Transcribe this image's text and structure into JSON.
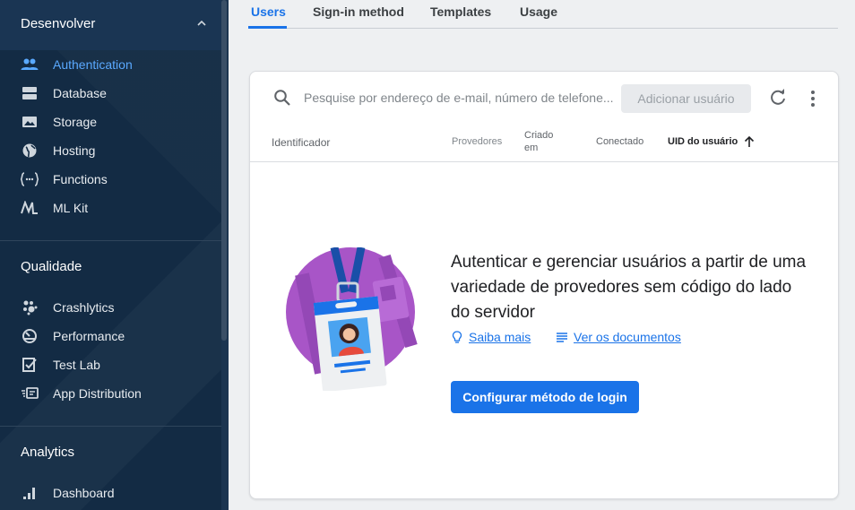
{
  "sidebar": {
    "sections": [
      {
        "title": "Desenvolver",
        "items": [
          {
            "label": "Authentication",
            "icon": "people-icon",
            "active": true
          },
          {
            "label": "Database",
            "icon": "database-icon"
          },
          {
            "label": "Storage",
            "icon": "storage-icon"
          },
          {
            "label": "Hosting",
            "icon": "globe-icon"
          },
          {
            "label": "Functions",
            "icon": "functions-icon"
          },
          {
            "label": "ML Kit",
            "icon": "ml-kit-icon"
          }
        ]
      },
      {
        "title": "Qualidade",
        "items": [
          {
            "label": "Crashlytics",
            "icon": "crashlytics-icon"
          },
          {
            "label": "Performance",
            "icon": "performance-icon"
          },
          {
            "label": "Test Lab",
            "icon": "test-lab-icon"
          },
          {
            "label": "App Distribution",
            "icon": "app-distribution-icon"
          }
        ]
      },
      {
        "title": "Analytics",
        "items": [
          {
            "label": "Dashboard",
            "icon": "dashboard-bars-icon"
          }
        ]
      }
    ]
  },
  "tabs": [
    "Users",
    "Sign-in method",
    "Templates",
    "Usage"
  ],
  "active_tab": "Users",
  "search": {
    "placeholder": "Pesquise por endereço de e-mail, número de telefone..."
  },
  "toolbar": {
    "add_user_label": "Adicionar usuário"
  },
  "table": {
    "headers": {
      "identifier": "Identificador",
      "providers": "Provedores",
      "created_line1": "Criado",
      "created_line2": "em",
      "signed_in": "Conectado",
      "uid": "UID do usuário"
    }
  },
  "empty_state": {
    "title": "Autenticar e gerenciar usuários a partir de uma variedade de provedores sem código do lado do servidor",
    "learn_more": "Saiba mais",
    "docs": "Ver os documentos",
    "cta": "Configurar método de login"
  },
  "colors": {
    "accent": "#1a73e8",
    "sidebar_bg": "#132b44",
    "active_nav": "#5aa9ff",
    "illustration_purple": "#a855c7"
  }
}
